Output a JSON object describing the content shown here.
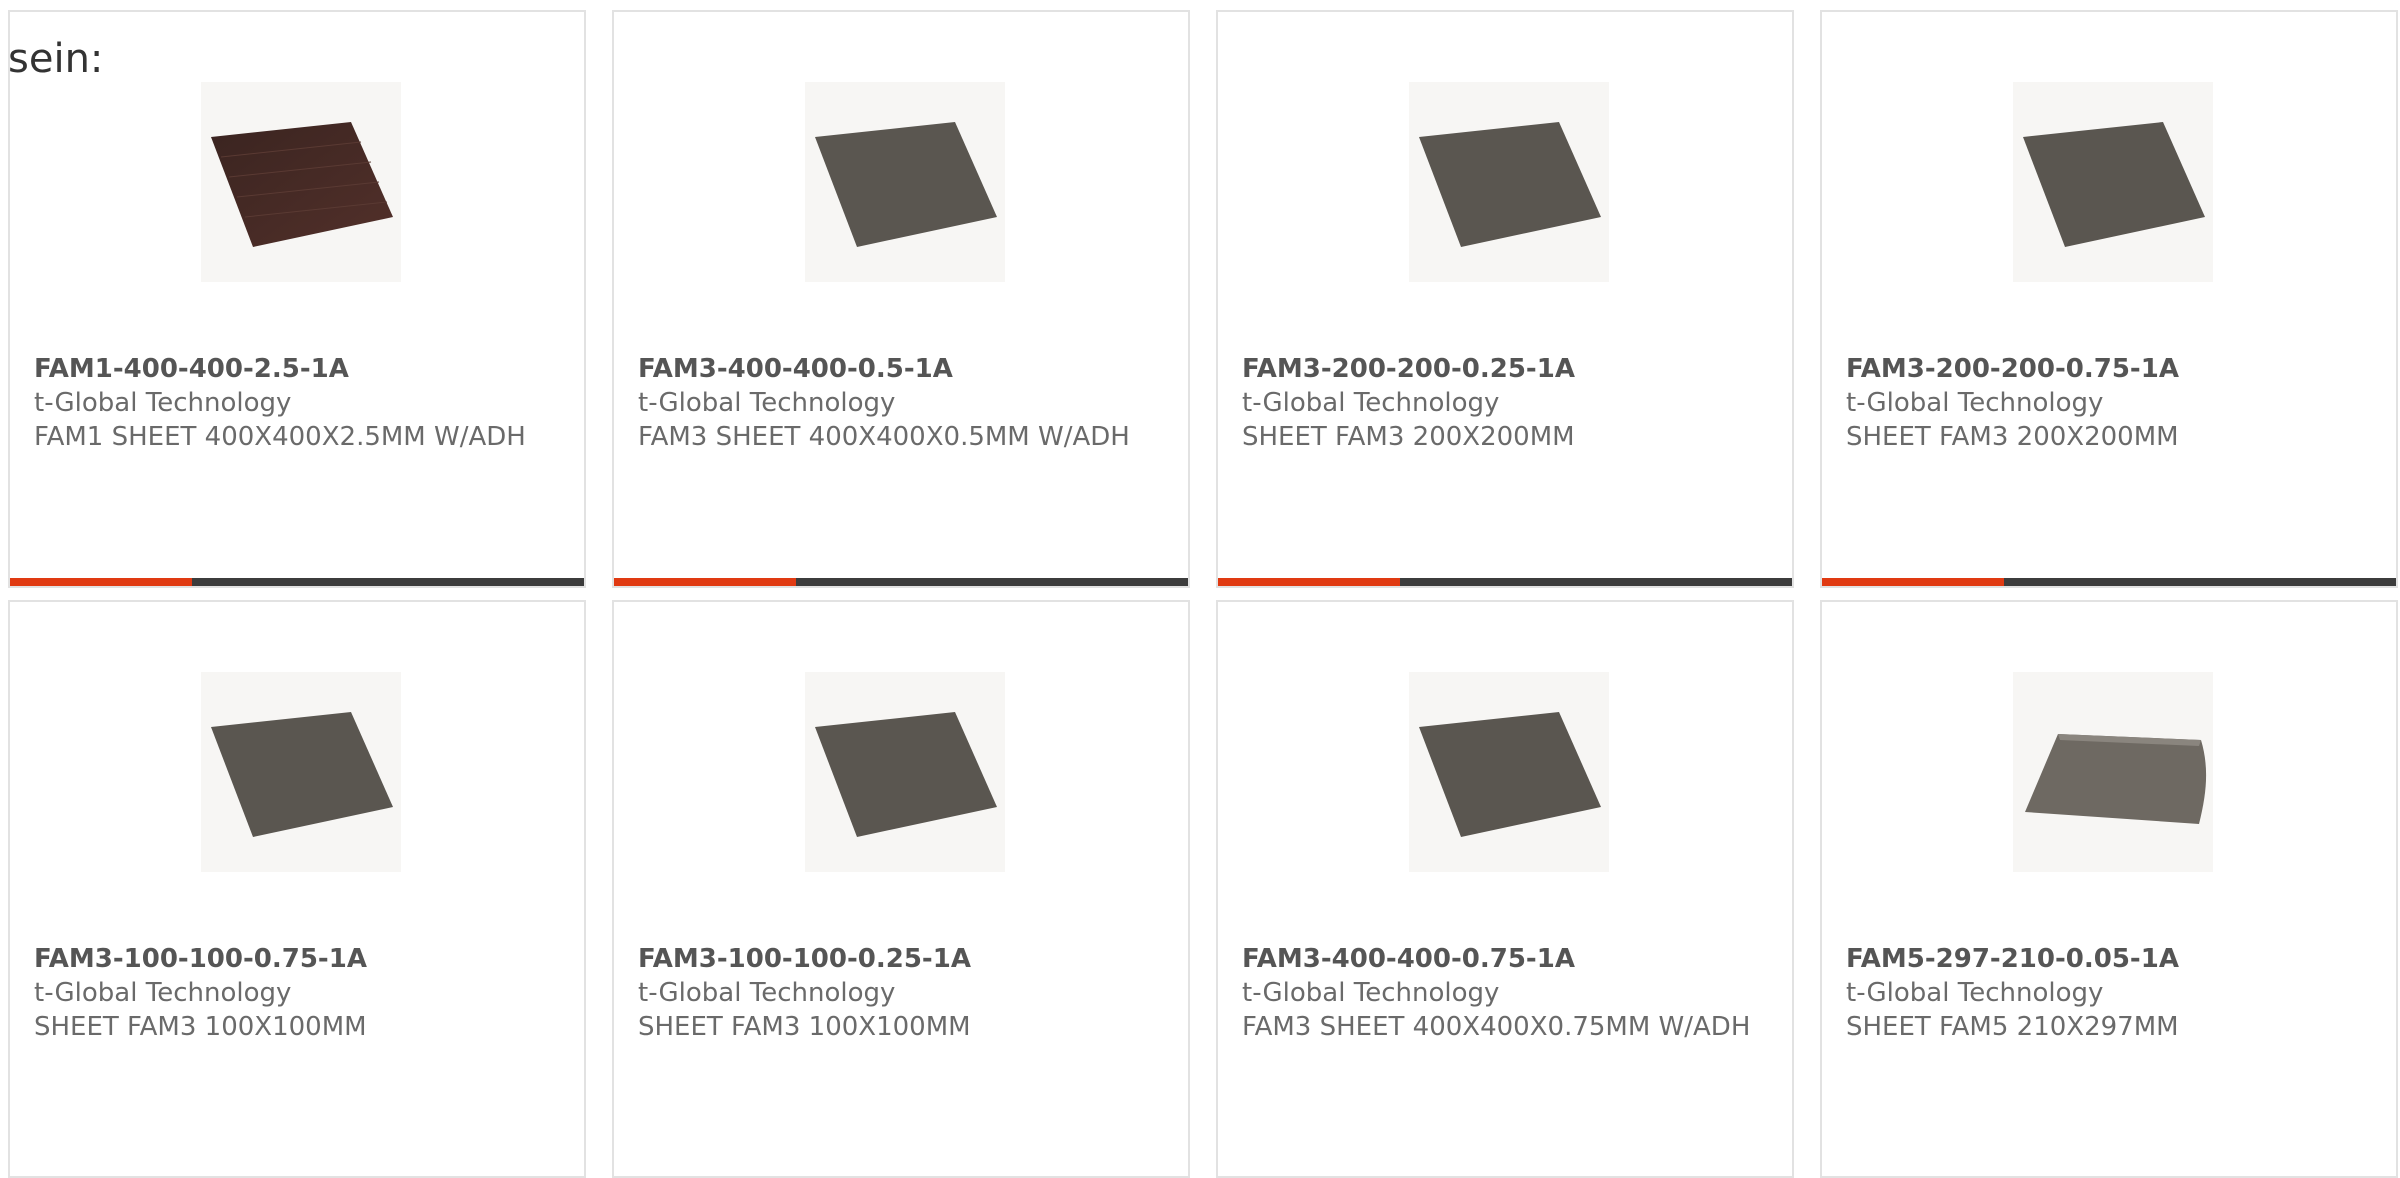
{
  "intro_text": "sein:",
  "colors": {
    "accent": "#e03a12",
    "bar": "#3c3c3c"
  },
  "products": [
    {
      "part": "FAM1-400-400-2.5-1A",
      "maker": "t-Global Technology",
      "desc": "FAM1 SHEET 400X400X2.5MM W/ADH",
      "image": "brown-sheet",
      "show_bar": true
    },
    {
      "part": "FAM3-400-400-0.5-1A",
      "maker": "t-Global Technology",
      "desc": "FAM3 SHEET 400X400X0.5MM W/ADH",
      "image": "gray-sheet",
      "show_bar": true
    },
    {
      "part": "FAM3-200-200-0.25-1A",
      "maker": "t-Global Technology",
      "desc": "SHEET FAM3 200X200MM",
      "image": "gray-sheet",
      "show_bar": true
    },
    {
      "part": "FAM3-200-200-0.75-1A",
      "maker": "t-Global Technology",
      "desc": "SHEET FAM3 200X200MM",
      "image": "gray-sheet",
      "show_bar": true
    },
    {
      "part": "FAM3-100-100-0.75-1A",
      "maker": "t-Global Technology",
      "desc": "SHEET FAM3 100X100MM",
      "image": "gray-sheet",
      "show_bar": false
    },
    {
      "part": "FAM3-100-100-0.25-1A",
      "maker": "t-Global Technology",
      "desc": "SHEET FAM3 100X100MM",
      "image": "gray-sheet",
      "show_bar": false
    },
    {
      "part": "FAM3-400-400-0.75-1A",
      "maker": "t-Global Technology",
      "desc": "FAM3 SHEET 400X400X0.75MM W/ADH",
      "image": "gray-sheet",
      "show_bar": false
    },
    {
      "part": "FAM5-297-210-0.05-1A",
      "maker": "t-Global Technology",
      "desc": "SHEET FAM5 210X297MM",
      "image": "curled-sheet",
      "show_bar": false
    }
  ]
}
